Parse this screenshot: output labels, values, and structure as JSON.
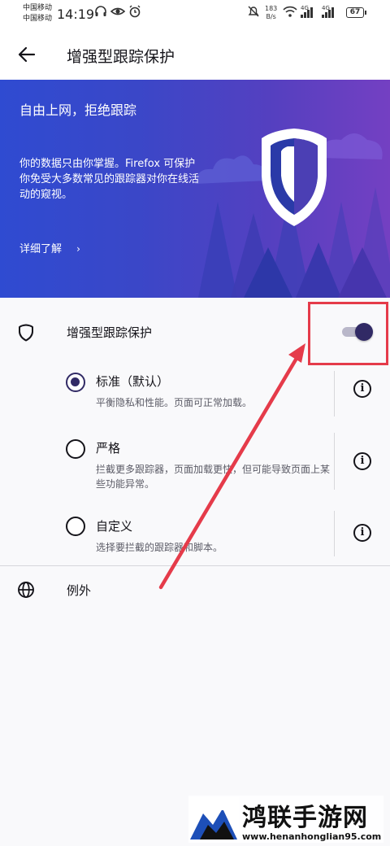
{
  "status_bar": {
    "carrier_1": "中国移动",
    "carrier_2": "中国移动",
    "time": "14:19",
    "net_speed_value": "183",
    "net_speed_unit": "B/s",
    "signal_1": "4G",
    "signal_2": "4G",
    "battery": "67"
  },
  "header": {
    "title": "增强型跟踪保护"
  },
  "hero": {
    "title": "自由上网，拒绝跟踪",
    "description": "你的数据只由你掌握。Firefox 可保护你免受大多数常见的跟踪器对你在线活动的窥视。",
    "learn_more": "详细了解",
    "learn_more_chevron": "›"
  },
  "protection": {
    "label": "增强型跟踪保护",
    "enabled": true
  },
  "options": [
    {
      "title": "标准（默认）",
      "description": "平衡隐私和性能。页面可正常加载。",
      "selected": true
    },
    {
      "title": "严格",
      "description": "拦截更多跟踪器，页面加载更快，但可能导致页面上某些功能异常。",
      "selected": false
    },
    {
      "title": "自定义",
      "description": "选择要拦截的跟踪器和脚本。",
      "selected": false
    }
  ],
  "info_glyph": "i",
  "exceptions": {
    "label": "例外"
  },
  "annotation": {
    "color": "#e53b4a"
  },
  "colors": {
    "accent": "#312a65",
    "hero_start": "#2f4bd1",
    "hero_end": "#7440c2"
  },
  "watermark": {
    "title": "鸿联手游网",
    "url": "www.henanhonglian95.com"
  }
}
